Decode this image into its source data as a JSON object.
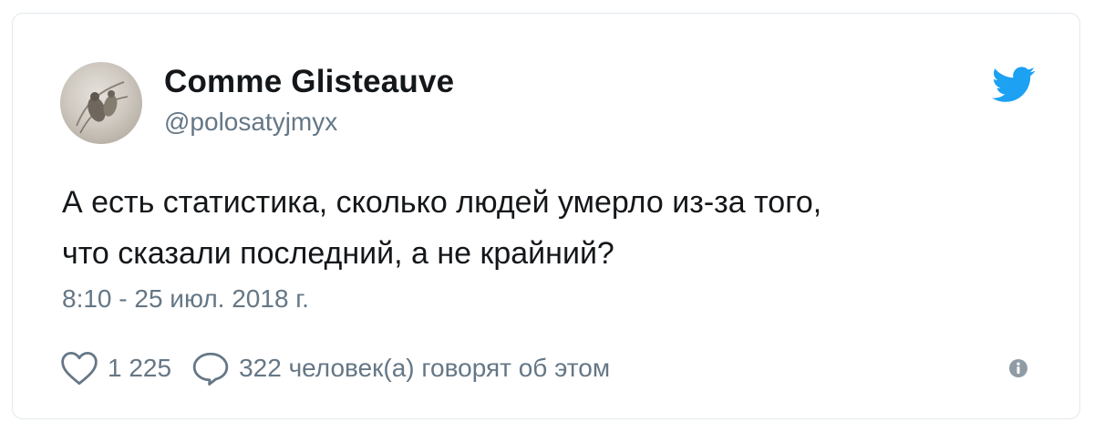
{
  "tweet": {
    "author": {
      "display_name": "Comme Glisteauve",
      "handle": "@polosatyjmyx"
    },
    "text_lines": [
      "А есть статистика, сколько людей умерло из-за того,",
      "что сказали последний, а не крайний?"
    ],
    "timestamp": "8:10 - 25 июл. 2018 г.",
    "likes": "1 225",
    "discussion": "322 человек(а) говорят об этом"
  },
  "icons": {
    "brand": "twitter-bird-icon",
    "like": "heart-icon",
    "reply": "speech-bubble-icon",
    "info": "info-icon"
  },
  "colors": {
    "twitter_blue": "#1da1f2",
    "secondary_text": "#657786",
    "primary_text": "#14171a",
    "border": "#e1e8ed"
  }
}
